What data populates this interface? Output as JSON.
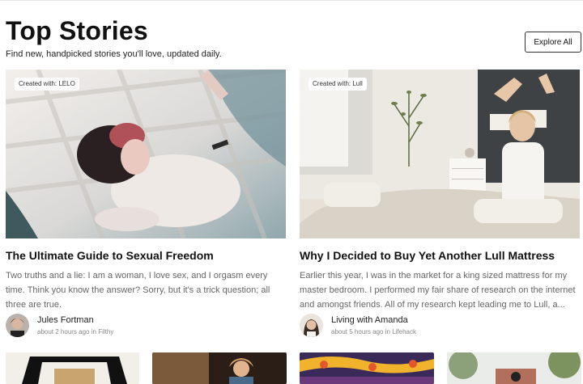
{
  "header": {
    "title": "Top Stories",
    "subtitle": "Find new, handpicked stories you'll love, updated daily.",
    "explore_label": "Explore All"
  },
  "stories": [
    {
      "badge": "Created with: LELO",
      "title": "The Ultimate Guide to Sexual Freedom",
      "excerpt": "Two truths and a lie: I am a woman, I love sex, and I orgasm every time. Think you know the answer? Sorry, but it's a trick question; all three are true.",
      "author": "Jules Fortman",
      "time": "about 2 hours ago",
      "in_word": "in",
      "publication": "Filthy"
    },
    {
      "badge": "Created with: Lull",
      "title": "Why I Decided to Buy Yet Another Lull Mattress",
      "excerpt": "Earlier this year, I was in the market for a king sized mattress for my master bedroom. I performed my fair share of research on the internet and amongst friends. All of my research kept leading me to Lull, a...",
      "author": "Living with Amanda",
      "time": "about 5 hours ago",
      "in_word": "in",
      "publication": "Lifehack"
    }
  ]
}
